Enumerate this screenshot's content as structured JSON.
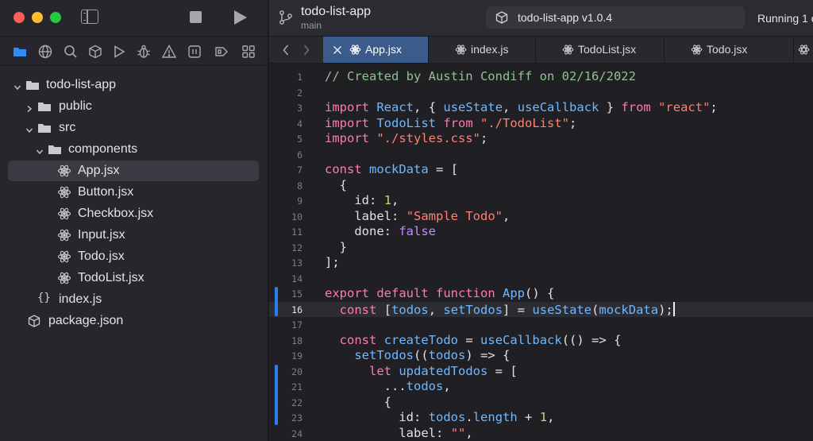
{
  "sidebar": {
    "tree": [
      {
        "label": "todo-list-app",
        "type": "folder",
        "expanded": true,
        "depth": 0
      },
      {
        "label": "public",
        "type": "folder",
        "expanded": false,
        "depth": 1
      },
      {
        "label": "src",
        "type": "folder",
        "expanded": true,
        "depth": 1
      },
      {
        "label": "components",
        "type": "folder",
        "expanded": true,
        "depth": 2
      },
      {
        "label": "App.jsx",
        "type": "react-file",
        "depth": 3,
        "selected": true
      },
      {
        "label": "Button.jsx",
        "type": "react-file",
        "depth": 3
      },
      {
        "label": "Checkbox.jsx",
        "type": "react-file",
        "depth": 3
      },
      {
        "label": "Input.jsx",
        "type": "react-file",
        "depth": 3
      },
      {
        "label": "Todo.jsx",
        "type": "react-file",
        "depth": 3
      },
      {
        "label": "TodoList.jsx",
        "type": "react-file",
        "depth": 3
      },
      {
        "label": "index.js",
        "type": "js-file",
        "depth": 2
      },
      {
        "label": "package.json",
        "type": "package-file",
        "depth": 1
      }
    ]
  },
  "toolbar": {
    "project_name": "todo-list-app",
    "branch": "main",
    "scheme_label": "todo-list-app v1.0.4",
    "run_status": "Running 1 o"
  },
  "tabs": [
    {
      "label": "App.jsx",
      "active": true
    },
    {
      "label": "index.js",
      "active": false
    },
    {
      "label": "TodoList.jsx",
      "active": false
    },
    {
      "label": "Todo.jsx",
      "active": false
    }
  ],
  "editor": {
    "current_line": 16,
    "lines": [
      {
        "n": "1",
        "text": "// Created by Austin Condiff on 02/16/2022"
      },
      {
        "n": "2",
        "text": ""
      },
      {
        "n": "3",
        "text": "import React, { useState, useCallback } from \"react\";"
      },
      {
        "n": "4",
        "text": "import TodoList from \"./TodoList\";"
      },
      {
        "n": "5",
        "text": "import \"./styles.css\";"
      },
      {
        "n": "6",
        "text": ""
      },
      {
        "n": "7",
        "text": "const mockData = ["
      },
      {
        "n": "8",
        "text": "  {"
      },
      {
        "n": "9",
        "text": "    id: 1,"
      },
      {
        "n": "10",
        "text": "    label: \"Sample Todo\","
      },
      {
        "n": "11",
        "text": "    done: false"
      },
      {
        "n": "12",
        "text": "  }"
      },
      {
        "n": "13",
        "text": "];"
      },
      {
        "n": "14",
        "text": ""
      },
      {
        "n": "15",
        "text": "export default function App() {"
      },
      {
        "n": "16",
        "text": "  const [todos, setTodos] = useState(mockData);"
      },
      {
        "n": "17",
        "text": ""
      },
      {
        "n": "18",
        "text": "  const createTodo = useCallback(() => {"
      },
      {
        "n": "19",
        "text": "    setTodos((todos) => {"
      },
      {
        "n": "20",
        "text": "      let updatedTodos = ["
      },
      {
        "n": "21",
        "text": "        ...todos,"
      },
      {
        "n": "22",
        "text": "        {"
      },
      {
        "n": "23",
        "text": "          id: todos.length + 1,"
      },
      {
        "n": "24",
        "text": "          label: \"\","
      }
    ]
  },
  "colors": {
    "accent": "#3b5b8a",
    "gutter_change": "#2a7ff0",
    "keyword": "#ff7ab2",
    "identifier": "#6fb8ff",
    "string": "#ff8170",
    "comment": "#8fc38f"
  }
}
